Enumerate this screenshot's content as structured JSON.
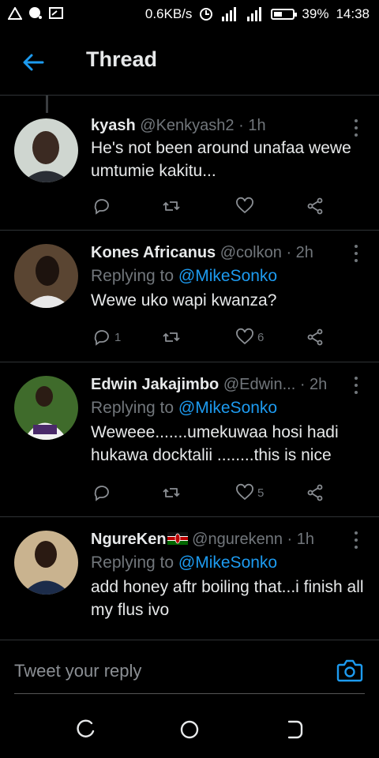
{
  "status_bar": {
    "speed": "0.6KB/s",
    "battery": "39%",
    "time": "14:38"
  },
  "header": {
    "title": "Thread"
  },
  "tweets": [
    {
      "name": "kyash",
      "handle": "@Kenkyash2",
      "time": "· 1h",
      "replying_to_prefix": "",
      "replying_to": "",
      "text": "He's not been around unafaa wewe umtumie kakitu...",
      "replies": "",
      "likes": ""
    },
    {
      "name": "Kones Africanus",
      "handle": "@colkon",
      "time": "· 2h",
      "replying_to_prefix": "Replying to ",
      "replying_to": "@MikeSonko",
      "text": "Wewe uko wapi kwanza?",
      "replies": "1",
      "likes": "6"
    },
    {
      "name": "Edwin Jakajimbo",
      "handle": "@Edwin...",
      "time": "· 2h",
      "replying_to_prefix": "Replying to ",
      "replying_to": "@MikeSonko",
      "text": "Weweee.......umekuwaa hosi   hadi hukawa docktalii  ........this is nice",
      "replies": "",
      "likes": "5"
    },
    {
      "name": "NgureKen",
      "handle": "@ngurekenn",
      "time": "· 1h",
      "replying_to_prefix": "Replying to ",
      "replying_to": "@MikeSonko",
      "text": "add honey aftr boiling that...i finish all my flus ivo",
      "replies": "",
      "likes": ""
    }
  ],
  "reply_box": {
    "placeholder": "Tweet your reply"
  },
  "icons": {
    "back": "back-arrow-icon",
    "more": "more-vertical-icon",
    "reply": "reply-icon",
    "retweet": "retweet-icon",
    "like": "heart-icon",
    "share": "share-icon",
    "camera": "camera-icon"
  },
  "colors": {
    "accent": "#1d9bf0",
    "background": "#000000",
    "muted": "#71767b"
  }
}
